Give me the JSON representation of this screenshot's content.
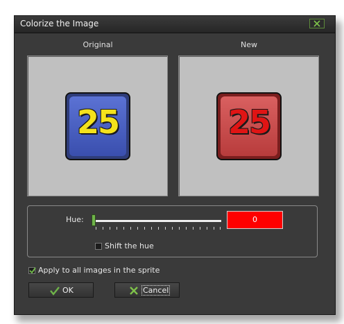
{
  "window": {
    "title": "Colorize the Image"
  },
  "previews": {
    "original_label": "Original",
    "new_label": "New",
    "original_number": "25",
    "new_number": "25"
  },
  "hue": {
    "label": "Hue:",
    "value": "0",
    "slider_fraction": 0,
    "swatch_color": "#ff0000",
    "shift_label": "Shift the hue",
    "shift_checked": false
  },
  "apply_all": {
    "label": "Apply to all images in the sprite",
    "checked": true
  },
  "buttons": {
    "ok": "OK",
    "cancel": "Cancel"
  },
  "colors": {
    "accent_green": "#6fb44a",
    "cancel_x": "#7ec24a"
  },
  "icons": {
    "close": "close-icon",
    "ok": "checkmark-icon",
    "cancel": "cross-icon"
  }
}
